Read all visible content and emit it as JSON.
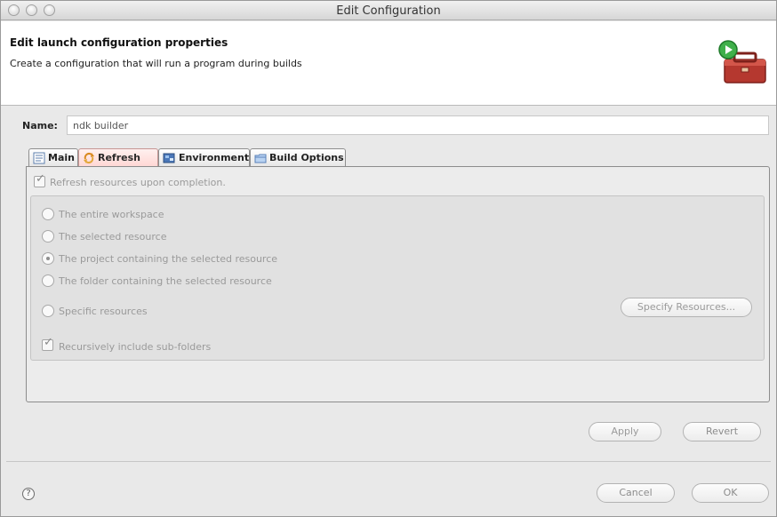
{
  "window": {
    "title": "Edit Configuration"
  },
  "header": {
    "title": "Edit launch configuration properties",
    "description": "Create a configuration that will run a program during builds",
    "icon": "toolbox-run-icon"
  },
  "name_field": {
    "label": "Name:",
    "value": "ndk builder"
  },
  "tabs": [
    {
      "label": "Main",
      "icon": "main-tab-icon",
      "active": false
    },
    {
      "label": "Refresh",
      "icon": "refresh-tab-icon",
      "active": true
    },
    {
      "label": "Environment",
      "icon": "environment-tab-icon",
      "active": false
    },
    {
      "label": "Build Options",
      "icon": "build-options-tab-icon",
      "active": false
    }
  ],
  "refresh": {
    "checkbox_label": "Refresh resources upon completion.",
    "checked": true,
    "radios": [
      {
        "label": "The entire workspace",
        "selected": false
      },
      {
        "label": "The selected resource",
        "selected": false
      },
      {
        "label": "The project containing the selected resource",
        "selected": true
      },
      {
        "label": "The folder containing the selected resource",
        "selected": false
      },
      {
        "label": "Specific resources",
        "selected": false
      }
    ],
    "specify_button": "Specify Resources...",
    "recursive_label": "Recursively include sub-folders",
    "recursive_checked": true
  },
  "actions": {
    "apply": "Apply",
    "revert": "Revert",
    "cancel": "Cancel",
    "ok": "OK"
  },
  "help_glyph": "?",
  "colors": {
    "active_tab": "#ffd6d3",
    "window_bg": "#e9e9e9",
    "panel_bg": "#ececec"
  }
}
